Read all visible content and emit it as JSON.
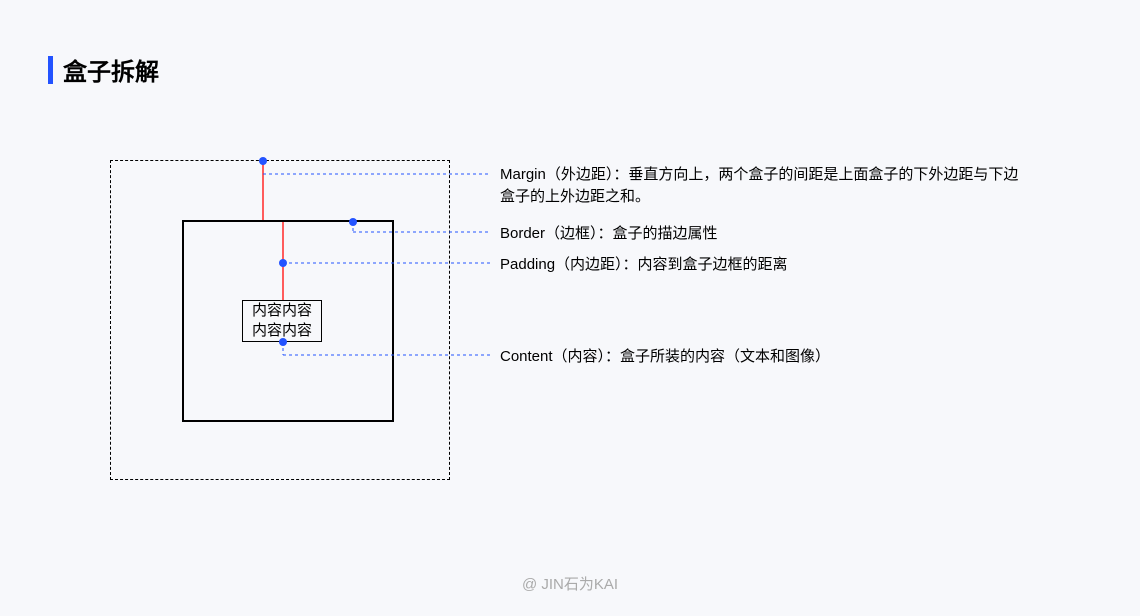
{
  "header": {
    "title": "盒子拆解"
  },
  "content_box": {
    "line1": "内容内容",
    "line2": "内容内容"
  },
  "annotations": {
    "margin": "Margin（外边距）：垂直方向上，两个盒子的间距是上面盒子的下外边距与下边盒子的上外边距之和。",
    "border": "Border（边框）：盒子的描边属性",
    "padding": "Padding（内边距）：内容到盒子边框的距离",
    "content": "Content（内容）：盒子所装的内容（文本和图像）"
  },
  "footer": {
    "attribution": "@ JIN石为KAI"
  }
}
